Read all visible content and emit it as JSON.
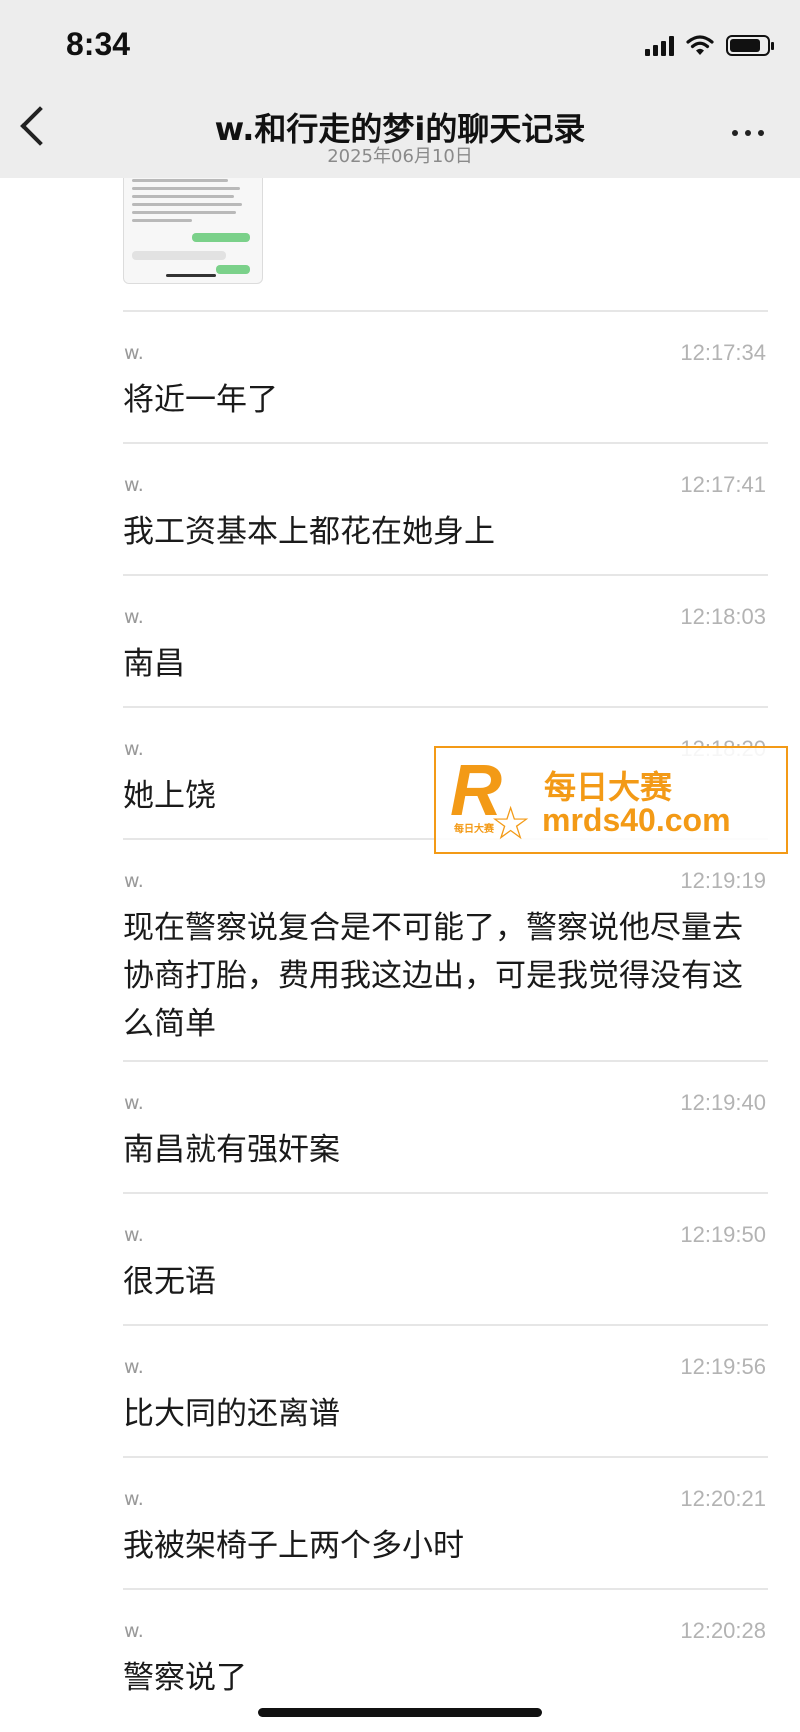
{
  "status": {
    "time": "8:34",
    "battery_level": 0.82
  },
  "nav": {
    "title": "w.和行走的梦i的聊天记录",
    "date": "2025年06月10日"
  },
  "messages": [
    {
      "sender": "w.",
      "time": "12:17:34",
      "text": "将近一年了"
    },
    {
      "sender": "w.",
      "time": "12:17:41",
      "text": "我工资基本上都花在她身上"
    },
    {
      "sender": "w.",
      "time": "12:18:03",
      "text": "南昌"
    },
    {
      "sender": "w.",
      "time": "12:18:20",
      "text": "她上饶"
    },
    {
      "sender": "w.",
      "time": "12:19:19",
      "text": "现在警察说复合是不可能了，警察说他尽量去协商打胎，费用我这边出，可是我觉得没有这么简单"
    },
    {
      "sender": "w.",
      "time": "12:19:40",
      "text": "南昌就有强奸案"
    },
    {
      "sender": "w.",
      "time": "12:19:50",
      "text": "很无语"
    },
    {
      "sender": "w.",
      "time": "12:19:56",
      "text": "比大同的还离谱"
    },
    {
      "sender": "w.",
      "time": "12:20:21",
      "text": "我被架椅子上两个多小时"
    },
    {
      "sender": "w.",
      "time": "12:20:28",
      "text": "警察说了"
    }
  ],
  "watermark": {
    "logo": "R",
    "small": "每日大赛",
    "title": "每日大赛",
    "url": "mrds40.com"
  },
  "colors": {
    "header_bg": "#ededed",
    "accent": "#f39a16",
    "divider": "#e6e6e6"
  }
}
